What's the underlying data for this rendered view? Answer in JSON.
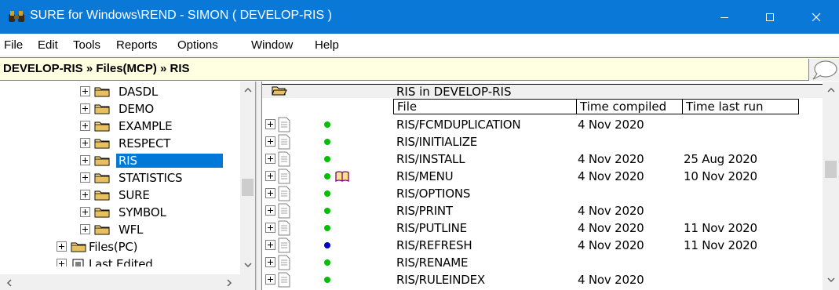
{
  "window": {
    "title": "SURE for Windows\\REND - SIMON ( DEVELOP-RIS )",
    "app_icon": "binoculars-icon",
    "controls": [
      "minimize-icon",
      "maximize-icon",
      "close-icon"
    ],
    "title_bar_color": "#0a78d7"
  },
  "menu": {
    "items": [
      "File",
      "Edit",
      "Tools",
      "Reports",
      "Options",
      "Window",
      "Help"
    ]
  },
  "pathbar": {
    "path": "DEVELOP-RIS » Files(MCP) » RIS",
    "bubble_icon": "speech-bubble-icon",
    "background": "#ffffe1"
  },
  "tree": {
    "items": [
      {
        "label": "DASDL",
        "level": 1,
        "selected": false,
        "icon": "folder-icon"
      },
      {
        "label": "DEMO",
        "level": 1,
        "selected": false,
        "icon": "folder-icon"
      },
      {
        "label": "EXAMPLE",
        "level": 1,
        "selected": false,
        "icon": "folder-icon"
      },
      {
        "label": "RESPECT",
        "level": 1,
        "selected": false,
        "icon": "folder-icon"
      },
      {
        "label": "RIS",
        "level": 1,
        "selected": true,
        "icon": "folder-icon"
      },
      {
        "label": "STATISTICS",
        "level": 1,
        "selected": false,
        "icon": "folder-icon"
      },
      {
        "label": "SURE",
        "level": 1,
        "selected": false,
        "icon": "folder-icon"
      },
      {
        "label": "SYMBOL",
        "level": 1,
        "selected": false,
        "icon": "folder-icon"
      },
      {
        "label": "WFL",
        "level": 1,
        "selected": false,
        "icon": "folder-icon"
      },
      {
        "label": "Files(PC)",
        "level": 0,
        "selected": false,
        "icon": "folder-icon"
      },
      {
        "label": "Last Edited",
        "level": 0,
        "selected": false,
        "icon": "recent-icon"
      }
    ],
    "selection_color": "#0078d7"
  },
  "files": {
    "heading": "RIS in DEVELOP-RIS",
    "heading_icon": "open-folder-icon",
    "columns": [
      "File",
      "Time compiled",
      "Time last run"
    ],
    "rows": [
      {
        "name": "RIS/FCMDUPLICATION",
        "compiled": "4 Nov 2020",
        "last_run": "",
        "status": "green",
        "book": false
      },
      {
        "name": "RIS/INITIALIZE",
        "compiled": "",
        "last_run": "",
        "status": "green",
        "book": false
      },
      {
        "name": "RIS/INSTALL",
        "compiled": "4 Nov 2020",
        "last_run": "25 Aug 2020",
        "status": "green",
        "book": false
      },
      {
        "name": "RIS/MENU",
        "compiled": "4 Nov 2020",
        "last_run": "10 Nov 2020",
        "status": "green",
        "book": true
      },
      {
        "name": "RIS/OPTIONS",
        "compiled": "",
        "last_run": "",
        "status": "green",
        "book": false
      },
      {
        "name": "RIS/PRINT",
        "compiled": "4 Nov 2020",
        "last_run": "",
        "status": "green",
        "book": false
      },
      {
        "name": "RIS/PUTLINE",
        "compiled": "4 Nov 2020",
        "last_run": "11 Nov 2020",
        "status": "green",
        "book": false
      },
      {
        "name": "RIS/REFRESH",
        "compiled": "4 Nov 2020",
        "last_run": "11 Nov 2020",
        "status": "blue",
        "book": false
      },
      {
        "name": "RIS/RENAME",
        "compiled": "",
        "last_run": "",
        "status": "green",
        "book": false
      },
      {
        "name": "RIS/RULEINDEX",
        "compiled": "4 Nov 2020",
        "last_run": "",
        "status": "green",
        "book": false
      }
    ],
    "status_colors": {
      "green": "#00c000",
      "blue": "#0000c0"
    }
  },
  "scrollbars": {
    "arrow_icons": [
      "chevron-up-icon",
      "chevron-down-icon",
      "chevron-left-icon",
      "chevron-right-icon"
    ]
  }
}
